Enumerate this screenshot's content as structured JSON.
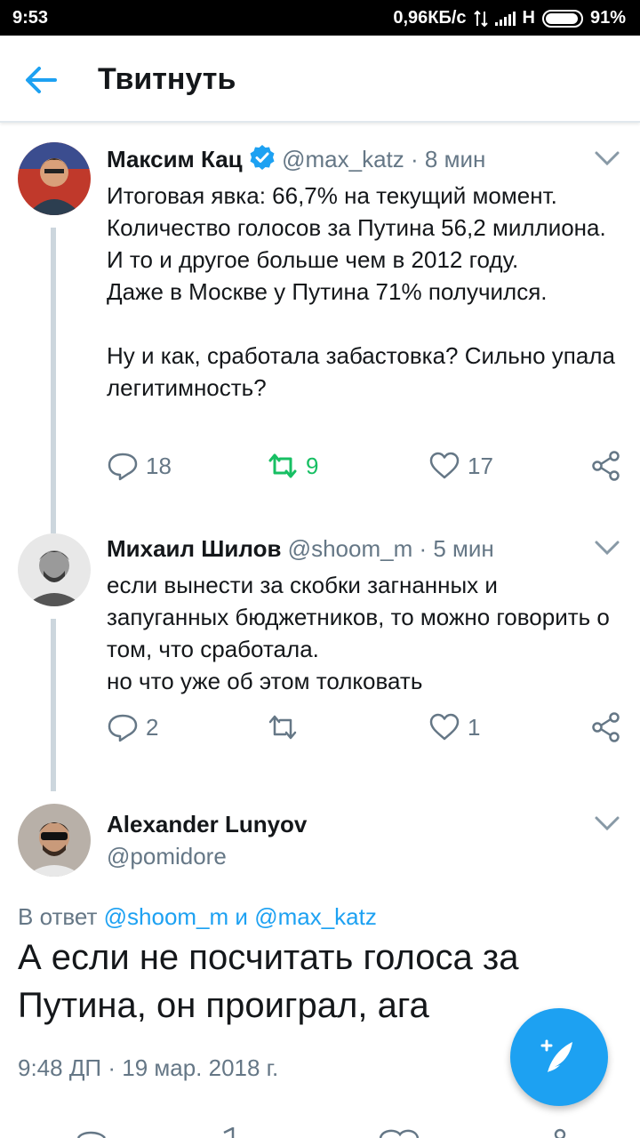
{
  "status_bar": {
    "time": "9:53",
    "network_speed": "0,96КБ/с",
    "network_type": "H",
    "battery": "91%"
  },
  "appbar": {
    "title": "Твитнуть",
    "back_icon": "arrow-left-icon"
  },
  "tweets": [
    {
      "name": "Максим Кац",
      "verified": true,
      "handle": "@max_katz",
      "time": "· 8 мин",
      "text": "Итоговая явка: 66,7% на текущий момент.\nКоличество голосов за Путина 56,2 миллиона. И то и другое больше чем в 2012 году.\nДаже в Москве у Путина 71% получился.\n\nНу и как, сработала забастовка? Сильно упала легитимность?",
      "replies": "18",
      "retweets": "9",
      "likes": "17"
    },
    {
      "name": "Михаил Шилов",
      "handle": "@shoom_m",
      "time": "· 5 мин",
      "text": "если вынести за скобки загнанных и запуганных бюджетников, то можно говорить о том, что сработала.\nно что уже об этом толковать",
      "replies": "2",
      "retweets": "",
      "likes": "1"
    }
  ],
  "focus_tweet": {
    "name": "Alexander Lunyov",
    "handle": "@pomidore",
    "reply_prefix": "В ответ",
    "reply_handle_1": "@shoom_m",
    "reply_and": "и",
    "reply_handle_2": "@max_katz",
    "text": "А если не посчитать голоса за Путина, он проиграл, ага",
    "timestamp": "9:48 ДП · 19 мар. 2018 г."
  },
  "colors": {
    "accent": "#1da1f2",
    "retweet_active": "#17bf63",
    "secondary_text": "#657786",
    "thread_line": "#ccd6dd"
  },
  "fab": {
    "icon": "compose-feather-icon"
  }
}
